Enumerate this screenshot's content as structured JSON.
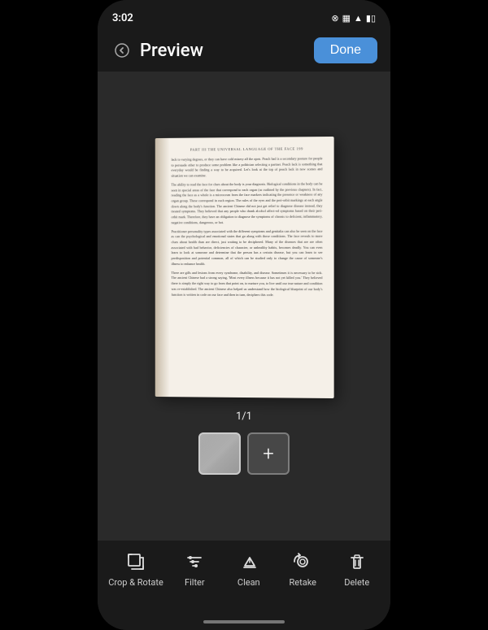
{
  "statusBar": {
    "time": "3:02",
    "icons": [
      "●",
      "◎",
      "📞",
      "⬆",
      "☰",
      "📶",
      "🔋"
    ]
  },
  "topBar": {
    "backIconLabel": "back",
    "title": "Preview",
    "doneButton": "Done"
  },
  "mainContent": {
    "pageCounter": "1/1",
    "pageHeader": "PART III   THE UNIVERSAL LANGUAGE OF THE FACE   199",
    "pageText": [
      "lack to varying degrees, or they can have cold misery all the open. Peach had is a secondary posture for people to persuade other to produce some problem like a politician selecting a partner. Peach lack is something that everyday would be finding a way to be acquired. Let's look at the top of peach lack in new scenes and situation we can examine.",
      "The ability to read the face for clues about the body is your diagnosis. Biological conditions in the body can be seen in special areas of the face that correspond to each organ (as outlined by the previous chapters). In fact, reading the face as a whole is a microcosm from the face markers indicating the presence or weakness of any organ group. These correspond in each region. The rules of the eyes and the peri-orbit markings at each angle down along the body's function. The ancient Chinese did not just get relief to diagnose disease instead, they treated symptoms. They believed that any people who drank alcohol affect-ed symptoms based on their peri-orbit mark. Therefore, they have an obligation to diagnose the symptoms of chronic to deficient, inflammatory, negative conditions, dangerous, or hot.",
      "Practitioner personality types associated with the different symptoms and genitalia can also be seen on the face as can the psychological and emotional states that go along with those conditions. The face reveals to more clues about health than are direct, just waiting to be deciphered. Many of the diseases that are are often associated with bad behavior, deficiencies of character, or unhealthy habits, becomes deadly. You can even learn to look at someone and determine that the person has a certain disease, but you can learn to see predisposition and potential common, all of which can be studied only to change the cause of someone's illness to enhance health.",
      "There are gills and lesions from every syndrome, disability, and disease. Sometimes it is necessary to be sick. The ancient Chinese had a strong saying, 'Most every illness because it has not yet killed you.' They believed there is simply the right way to go from that point on, to nurture you, to live until our true nature and condition was re-established. The ancient Chinese also helped us understand how the biological blueprint of our body's function is written in code on our face and then in turn, deciphers this code."
    ]
  },
  "thumbnailStrip": {
    "addButtonLabel": "+",
    "thumbCount": 1
  },
  "toolbar": {
    "items": [
      {
        "id": "crop-rotate",
        "label": "Crop & Rotate",
        "icon": "crop-rotate-icon"
      },
      {
        "id": "filter",
        "label": "Filter",
        "icon": "filter-icon"
      },
      {
        "id": "clean",
        "label": "Clean",
        "icon": "clean-icon"
      },
      {
        "id": "retake",
        "label": "Retake",
        "icon": "retake-icon"
      },
      {
        "id": "delete",
        "label": "Delete",
        "icon": "delete-icon"
      }
    ]
  },
  "colors": {
    "background": "#1a1a1a",
    "accent": "#4a90d9",
    "toolbarBg": "#1a1a1a",
    "pageBackground": "#f5f0e8"
  }
}
